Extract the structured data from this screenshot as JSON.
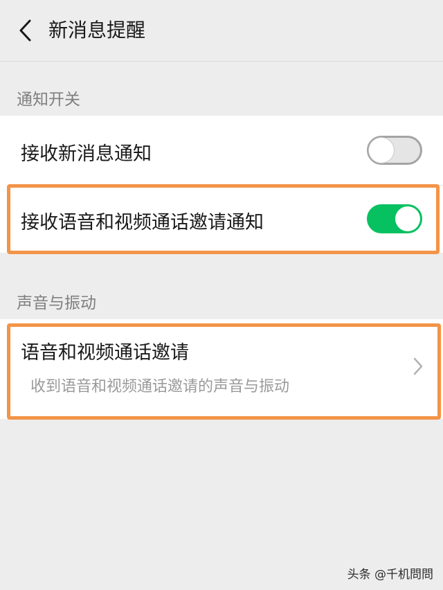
{
  "header": {
    "back_icon": "chevron-left-icon",
    "title": "新消息提醒"
  },
  "sections": [
    {
      "title": "通知开关",
      "rows": [
        {
          "label": "接收新消息通知",
          "toggle": "off"
        },
        {
          "label": "接收语音和视频通话邀请通知",
          "toggle": "on"
        }
      ]
    },
    {
      "title": "声音与振动",
      "rows": [
        {
          "label": "语音和视频通话邀请",
          "subtitle": "收到语音和视频通话邀请的声音与振动",
          "icon": "chevron-right-icon"
        }
      ]
    }
  ],
  "watermark": "头条 @千机問問",
  "colors": {
    "toggle_on": "#07c160",
    "toggle_off": "#e5e5e5",
    "highlight": "#f39447",
    "background": "#ededed"
  }
}
